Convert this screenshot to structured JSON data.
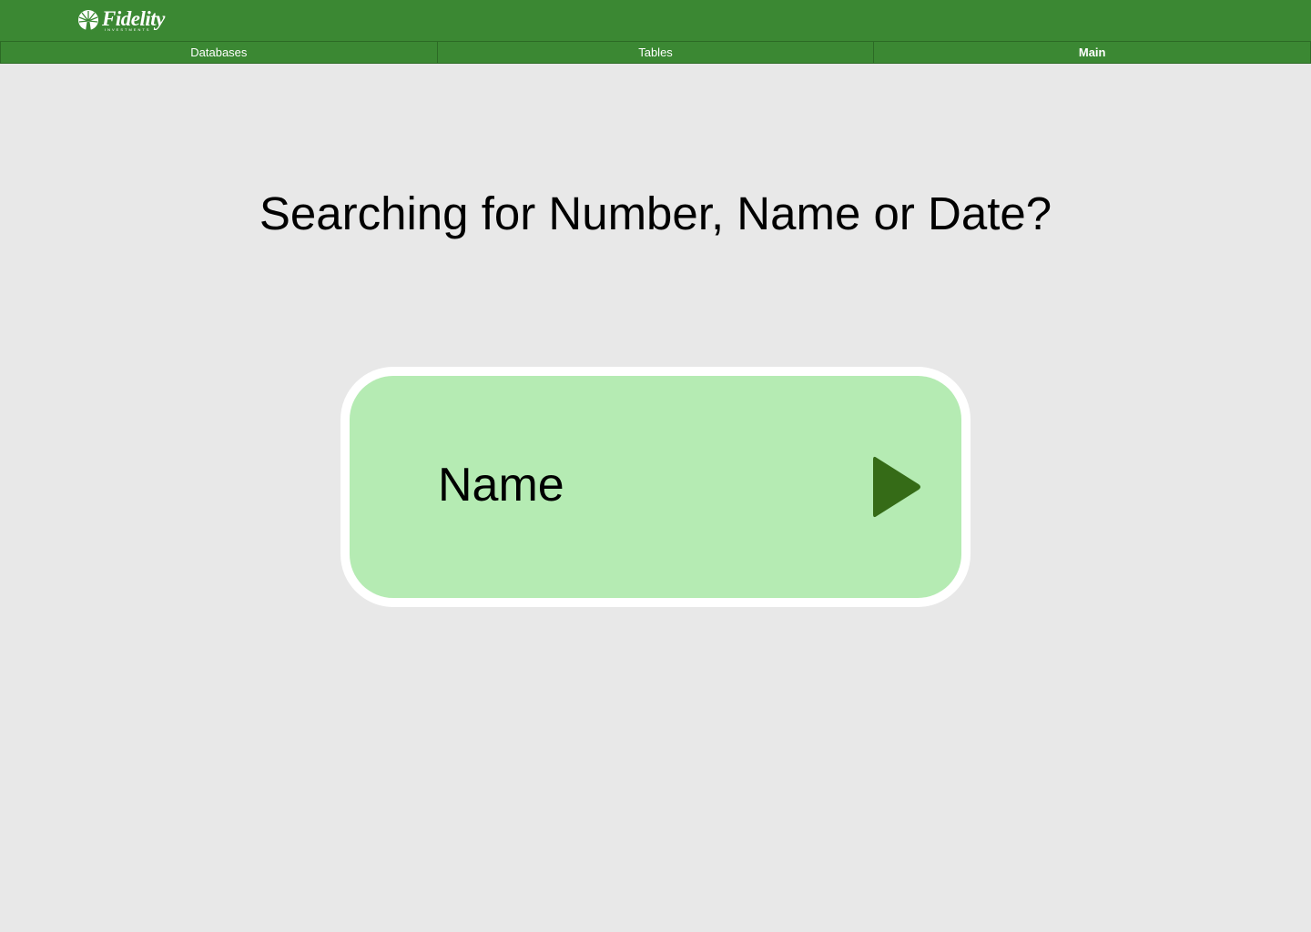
{
  "header": {
    "logo": {
      "text": "Fidelity",
      "subtext": "INVESTMENTS",
      "icon": "fidelity-sunburst-icon"
    },
    "background_color": "#3b8833"
  },
  "nav": {
    "tabs": [
      {
        "label": "Databases",
        "active": false
      },
      {
        "label": "Tables",
        "active": false
      },
      {
        "label": "Main",
        "active": true
      }
    ]
  },
  "main": {
    "title": "Searching for Number, Name or Date?",
    "choice": {
      "label": "Name",
      "icon": "play-arrow-icon",
      "background_color": "#b5ebb3",
      "icon_color": "#356b17"
    }
  }
}
